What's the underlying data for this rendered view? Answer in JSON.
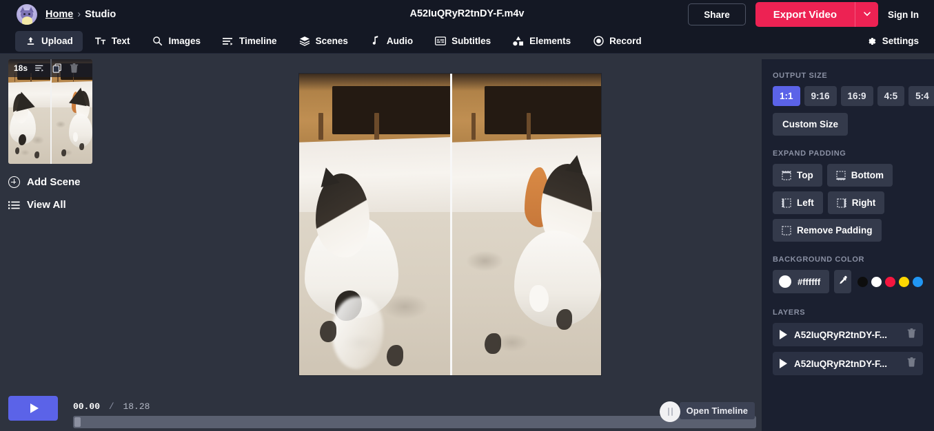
{
  "header": {
    "breadcrumb": {
      "home": "Home",
      "separator": "›",
      "current": "Studio"
    },
    "document_title": "A52IuQRyR2tnDY-F.m4v",
    "share_label": "Share",
    "export_label": "Export Video",
    "export_caret_icon": "chevron-down-icon",
    "sign_in_label": "Sign In",
    "avatar_icon": "cat-avatar-icon",
    "accent_color": "#ed2253"
  },
  "nav": {
    "items": [
      {
        "label": "Upload",
        "icon": "upload-icon",
        "active": true
      },
      {
        "label": "Text",
        "icon": "text-icon",
        "active": false
      },
      {
        "label": "Images",
        "icon": "search-icon",
        "active": false
      },
      {
        "label": "Timeline",
        "icon": "timeline-icon",
        "active": false
      },
      {
        "label": "Scenes",
        "icon": "layers-icon",
        "active": false
      },
      {
        "label": "Audio",
        "icon": "music-note-icon",
        "active": false
      },
      {
        "label": "Subtitles",
        "icon": "subtitles-icon",
        "active": false
      },
      {
        "label": "Elements",
        "icon": "shapes-icon",
        "active": false
      },
      {
        "label": "Record",
        "icon": "record-icon",
        "active": false
      }
    ],
    "settings_label": "Settings",
    "settings_icon": "gear-icon"
  },
  "scenes": {
    "scene": {
      "duration": "18s",
      "timeline_icon": "timeline-icon",
      "duplicate_icon": "copy-icon",
      "delete_icon": "trash-icon"
    },
    "add_scene_label": "Add Scene",
    "add_scene_icon": "circle-plus-icon",
    "view_all_label": "View All",
    "view_all_icon": "list-icon"
  },
  "right_panel": {
    "output_size": {
      "label": "Output Size",
      "ratios": [
        {
          "label": "1:1",
          "active": true
        },
        {
          "label": "9:16",
          "active": false
        },
        {
          "label": "16:9",
          "active": false
        },
        {
          "label": "4:5",
          "active": false
        },
        {
          "label": "5:4",
          "active": false
        }
      ],
      "custom_label": "Custom Size",
      "active_color": "#5b63e8"
    },
    "expand_padding": {
      "label": "Expand Padding",
      "buttons": [
        {
          "label": "Top",
          "icon": "pad-top-icon"
        },
        {
          "label": "Bottom",
          "icon": "pad-bottom-icon"
        },
        {
          "label": "Left",
          "icon": "pad-left-icon"
        },
        {
          "label": "Right",
          "icon": "pad-right-icon"
        },
        {
          "label": "Remove Padding",
          "icon": "pad-remove-icon"
        }
      ]
    },
    "background_color": {
      "label": "Background Color",
      "hex": "#ffffff",
      "picker_icon": "eyedropper-icon",
      "swatches": [
        "#0d0d0d",
        "#ffffff",
        "#f5163f",
        "#fdd602",
        "#2196f3"
      ]
    },
    "layers": {
      "label": "Layers",
      "items": [
        {
          "name": "A52IuQRyR2tnDY-F...",
          "play_icon": "play-icon",
          "delete_icon": "trash-icon"
        },
        {
          "name": "A52IuQRyR2tnDY-F...",
          "play_icon": "play-icon",
          "delete_icon": "trash-icon"
        }
      ]
    }
  },
  "player": {
    "play_icon": "play-icon",
    "current_time": "00.00",
    "time_separator": "/",
    "total_time": "18.28",
    "open_timeline_label": "Open Timeline",
    "drag_handle_icon": "drag-handle-icon",
    "progress_percent": 0
  }
}
